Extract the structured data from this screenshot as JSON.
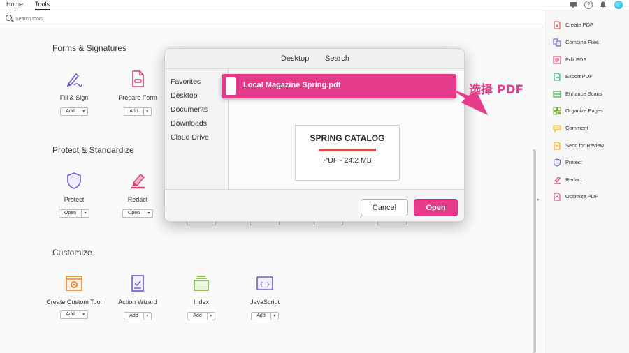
{
  "top_menu": {
    "tabs": [
      "Home",
      "Tools"
    ],
    "active": "Tools"
  },
  "search": {
    "placeholder": "Search tools"
  },
  "sections": [
    {
      "title": "Forms & Signatures",
      "tools": [
        {
          "name": "Fill & Sign",
          "button": "Add"
        },
        {
          "name": "Prepare Form",
          "button": "Add"
        }
      ]
    },
    {
      "title": "Protect & Standardize",
      "tools": [
        {
          "name": "Protect",
          "button": "Open"
        },
        {
          "name": "Redact",
          "button": "Open"
        }
      ]
    },
    {
      "title": "Customize",
      "tools": [
        {
          "name": "Create Custom Tool",
          "button": "Add"
        },
        {
          "name": "Action Wizard",
          "button": "Add"
        },
        {
          "name": "Index",
          "button": "Add"
        },
        {
          "name": "JavaScript",
          "button": "Add"
        }
      ]
    }
  ],
  "right_panel": {
    "items": [
      {
        "label": "Create PDF",
        "icon": "create-pdf-icon",
        "color": "#d9534f"
      },
      {
        "label": "Combine Files",
        "icon": "combine-files-icon",
        "color": "#6a5acd"
      },
      {
        "label": "Edit PDF",
        "icon": "edit-pdf-icon",
        "color": "#e0457b"
      },
      {
        "label": "Export PDF",
        "icon": "export-pdf-icon",
        "color": "#2e9c6a"
      },
      {
        "label": "Enhance Scans",
        "icon": "enhance-scans-icon",
        "color": "#3aa34a"
      },
      {
        "label": "Organize Pages",
        "icon": "organize-pages-icon",
        "color": "#7cb342"
      },
      {
        "label": "Comment",
        "icon": "comment-icon",
        "color": "#f2b81d"
      },
      {
        "label": "Send for Review",
        "icon": "send-for-review-icon",
        "color": "#e8a317"
      },
      {
        "label": "Protect",
        "icon": "protect-icon",
        "color": "#6a5acd"
      },
      {
        "label": "Redact",
        "icon": "redact-icon",
        "color": "#d6456f"
      },
      {
        "label": "Optimize PDF",
        "icon": "optimize-pdf-icon",
        "color": "#e0457b"
      }
    ]
  },
  "dialog": {
    "tabs": [
      "Desktop",
      "Search"
    ],
    "sidebar": [
      "Favorites",
      "Desktop",
      "Documents",
      "Downloads",
      "Cloud Drive"
    ],
    "selected_file": "Local Magazine Spring.pdf",
    "preview": {
      "title": "SPRING CATALOG",
      "meta": "PDF · 24.2 MB"
    },
    "cancel_label": "Cancel",
    "open_label": "Open"
  },
  "callout": {
    "text": "选择 PDF",
    "color": "#e63a8a"
  },
  "colors": {
    "accent": "#e63a8a",
    "tool_icon": "#6a5acd"
  }
}
